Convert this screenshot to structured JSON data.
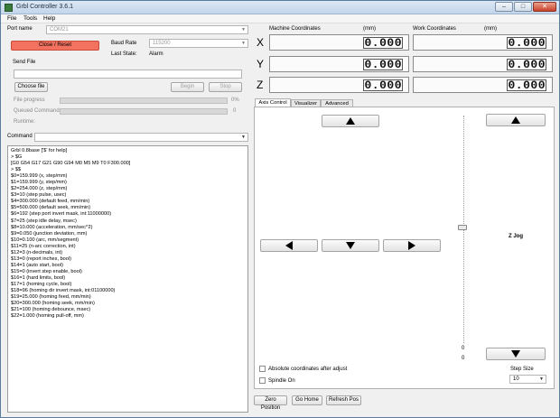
{
  "window": {
    "title": "Grbl Controller 3.6.1",
    "min": "–",
    "max": "□",
    "close": "✕"
  },
  "menu": [
    "File",
    "Tools",
    "Help"
  ],
  "port": {
    "label": "Port name",
    "value": "COM21"
  },
  "baud": {
    "label": "Baud Rate",
    "value": "115200"
  },
  "close_reset": "Close / Reset",
  "last_state": {
    "label": "Last State:",
    "value": "Alarm"
  },
  "send_file": "Send File",
  "choose_file": "Choose file",
  "begin": "Begin",
  "stop": "Stop",
  "file_progress": {
    "label": "File progress",
    "value": "0%",
    "fraction": 0
  },
  "queued": {
    "label": "Queued Commands",
    "value": "0"
  },
  "runtime": "Runtime:",
  "command_label": "Command",
  "console_lines": [
    "Grbl 0.8base ['$' for help]",
    "> $G",
    "[G0 G54 G17 G21 G90 G94 M0 M5 M9 T0 F300.000]",
    "> $$",
    "$0=159.999 (x, step/mm)",
    "$1=159.999 (y, step/mm)",
    "$2=254.000 (z, step/mm)",
    "$3=10 (step pulse, usec)",
    "$4=300.000 (default feed, mm/min)",
    "$5=500.000 (default seek, mm/min)",
    "$6=192 (step port invert mask, int:11000000)",
    "$7=25 (step idle delay, msec)",
    "$8=10.000 (acceleration, mm/sec^2)",
    "$9=0.050 (junction deviation, mm)",
    "$10=0.100 (arc, mm/segment)",
    "$11=25 (n-arc correction, int)",
    "$12=3 (n-decimals, int)",
    "$13=0 (report inches, bool)",
    "$14=1 (auto start, bool)",
    "$15=0 (invert step enable, bool)",
    "$16=1 (hard limits, bool)",
    "$17=1 (homing cycle, bool)",
    "$18=96 (homing dir invert mask, int:01100000)",
    "$19=25.000 (homing feed, mm/min)",
    "$20=300.000 (homing seek, mm/min)",
    "$21=100 (homing debounce, msec)",
    "$22=1.000 (homing pull-off, mm)"
  ],
  "machine": {
    "label": "Machine Coordinates",
    "unit": "(mm)",
    "x": "0.000",
    "y": "0.000",
    "z": "0.000"
  },
  "work": {
    "label": "Work Coordinates",
    "unit": "(mm)",
    "x": "0.000",
    "y": "0.000",
    "z": "0.000"
  },
  "axes": [
    "X",
    "Y",
    "Z"
  ],
  "tabs": [
    "Axis Control",
    "Visualizer",
    "Advanced"
  ],
  "z_jog": "Z Jog",
  "slider": {
    "max_label": "0",
    "min_label": "0"
  },
  "absolute_coords": "Absolute coordinates after adjust",
  "spindle_on": "Spindle On",
  "step_size": {
    "label": "Step Size",
    "value": "10"
  },
  "bottom_buttons": [
    "Zero Position",
    "Go Home",
    "Refresh Pos"
  ]
}
